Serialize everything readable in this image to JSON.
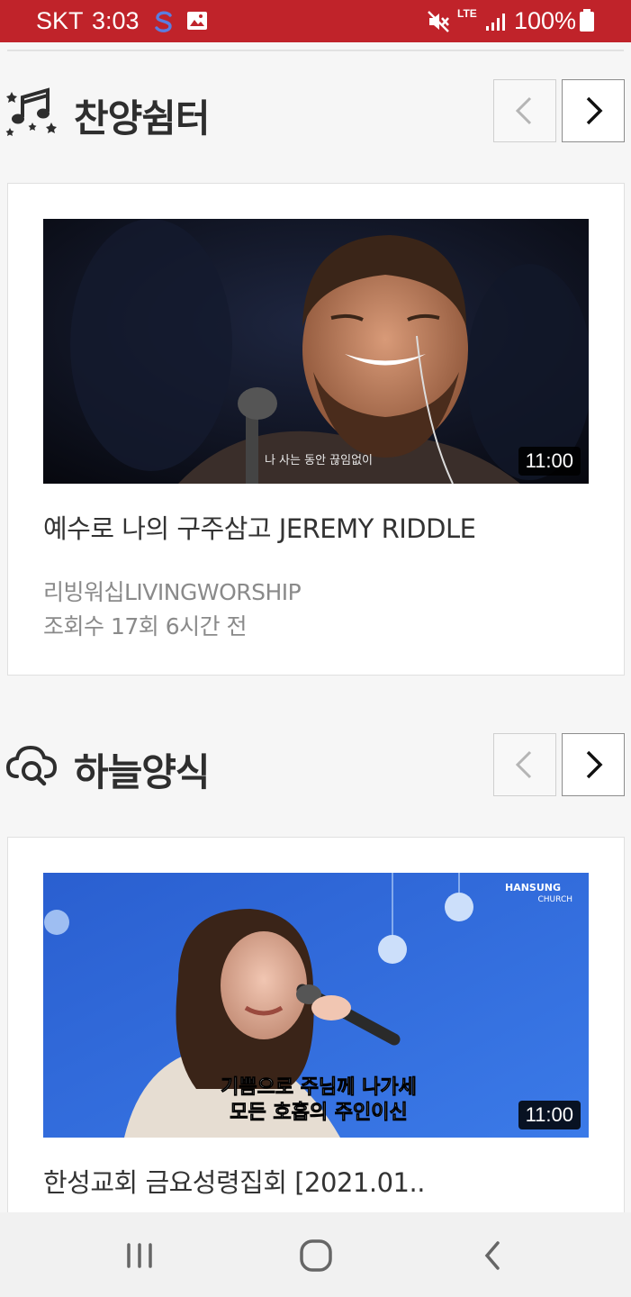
{
  "status_bar": {
    "carrier": "SKT",
    "time": "3:03",
    "network": "LTE",
    "battery": "100%",
    "icons": [
      "s-app-icon",
      "gallery-icon",
      "mute-icon",
      "signal-icon",
      "battery-icon"
    ]
  },
  "sections": [
    {
      "title": "찬양쉼터",
      "icon": "music-notes-icon",
      "video": {
        "title": "예수로 나의 구주삼고 JEREMY RIDDLE",
        "channel": "리빙워십LIVINGWORSHIP",
        "meta": "조회수 17회 6시간 전",
        "duration": "11:00",
        "caption": "나 사는 동안 끊임없이"
      }
    },
    {
      "title": "하늘양식",
      "icon": "cloud-search-icon",
      "video": {
        "title": "한성교회 금요성령집회 [2021.01..",
        "duration": "11:00",
        "caption_line1": "기쁨으로 주님께 나가세",
        "caption_line2": "모든 호흡의 주인이신",
        "watermark_line1": "HANSUNG",
        "watermark_line2": "CHURCH"
      }
    }
  ],
  "colors": {
    "status_bar": "#c0232a",
    "background": "#f6f6f6",
    "title_text": "#2e2e2e",
    "meta_text": "#8a8a8a"
  }
}
